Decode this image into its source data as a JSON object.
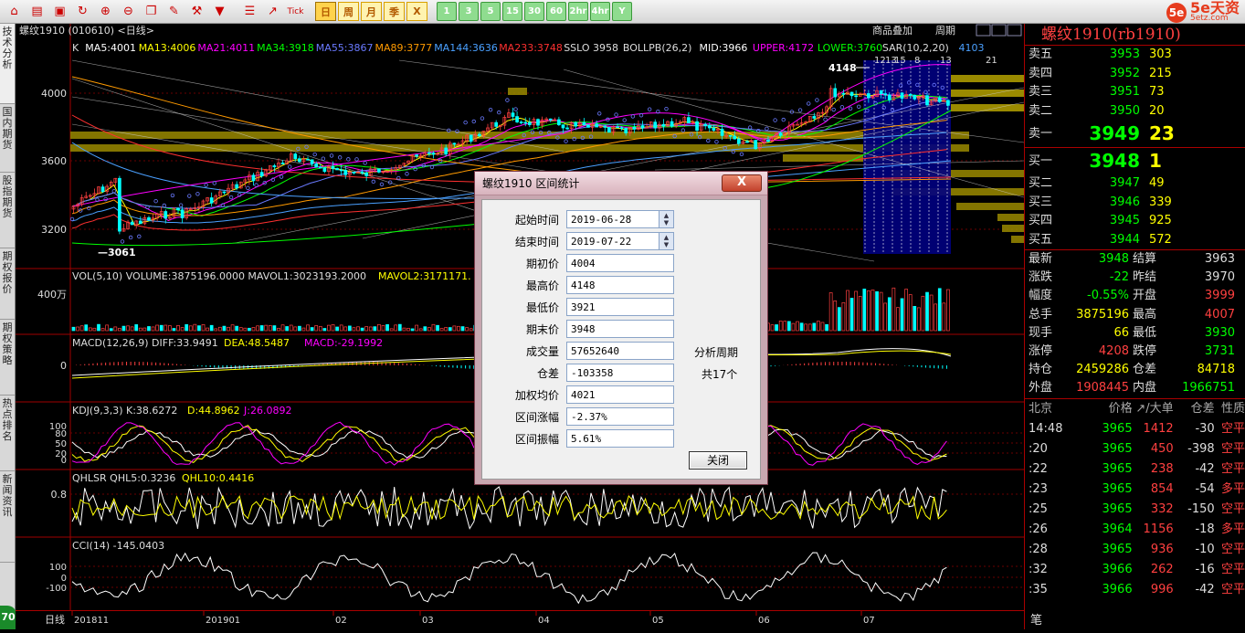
{
  "toolbar": {
    "icons": [
      "home-icon",
      "data-icon",
      "f10-icon",
      "refresh-icon",
      "zoom-in-icon",
      "zoom-out-icon",
      "window-icon",
      "pen-icon",
      "tool-icon",
      "filter-icon",
      "table-icon",
      "trend-icon",
      "tick-icon"
    ],
    "tick_label": "Tick",
    "periods": [
      "日",
      "周",
      "月",
      "季",
      "X"
    ],
    "minutes": [
      "1",
      "3",
      "5",
      "15",
      "30",
      "60",
      "2hr",
      "4hr",
      "Y"
    ],
    "selected_period": "日"
  },
  "logo": {
    "circle": "5e",
    "text": "5e天资",
    "sub": "5etz.com"
  },
  "left_tabs": [
    "技术分析",
    "国内期货",
    "股指期货",
    "期权报价",
    "期权策略",
    "热点排名",
    "新闻资讯"
  ],
  "badge": "70",
  "chart": {
    "header_label": "螺纹1910 (010610) <日线>",
    "top_right_labels": [
      "商品叠加",
      "周期"
    ],
    "ma_line": [
      {
        "text": "K",
        "color": "#dddddd"
      },
      {
        "text": "MA5:4001",
        "color": "#ffffff"
      },
      {
        "text": "MA13:4006",
        "color": "#ffff00"
      },
      {
        "text": "MA21:4011",
        "color": "#ff00ff"
      },
      {
        "text": "MA34:3918",
        "color": "#00ff00"
      },
      {
        "text": "MA55:3867",
        "color": "#6a7aff"
      },
      {
        "text": "MA89:3777",
        "color": "#ff9a00"
      },
      {
        "text": "MA144:3636",
        "color": "#4aa0ff"
      },
      {
        "text": "MA233:3748",
        "color": "#ff3030"
      },
      {
        "text": "SSLO 3958",
        "color": "#dddddd"
      },
      {
        "text": "BOLLPB(26,2)",
        "color": "#dddddd"
      },
      {
        "text": "MID:3966",
        "color": "#ffffff"
      },
      {
        "text": "UPPER:4172",
        "color": "#ff00ff"
      },
      {
        "text": "LOWER:3760",
        "color": "#00ff00"
      },
      {
        "text": "SAR(10,2,20)",
        "color": "#dddddd"
      },
      {
        "text": "4103",
        "color": "#4aa0ff"
      }
    ],
    "price_ticks": [
      "4000",
      "3600",
      "3200"
    ],
    "high_marker": "4148",
    "low_marker": "3061",
    "vol_label": "VOL(5,10) VOLUME:3875196.0000 MAVOL1:3023193.2000",
    "vol_label2": "MAVOL2:3171171.",
    "vol_tick": "400万",
    "macd_label": "MACD(12,26,9) DIFF:33.9491",
    "macd_dea": "DEA:48.5487",
    "macd_val": "MACD:-29.1992",
    "macd_tick": "0",
    "kdj_label": "KDJ(9,3,3) K:38.6272",
    "kdj_d": "D:44.8962",
    "kdj_j": "J:26.0892",
    "kdj_ticks": [
      "100",
      "80",
      "50",
      "20",
      "0"
    ],
    "qhlsr_label": "QHLSR QHL5:0.3236",
    "qhlsr_2": "QHL10:0.4416",
    "qhlsr_tick": "0.8",
    "cci_label": "CCI(14) -145.0403",
    "cci_ticks": [
      "100",
      "0",
      "-100"
    ],
    "interval_days": [
      "12",
      "13",
      "15",
      "8",
      "13",
      "21"
    ]
  },
  "xaxis": {
    "period": "日线",
    "labels": [
      "201811",
      "201901",
      "02",
      "03",
      "04",
      "05",
      "06",
      "07"
    ]
  },
  "right_panel": {
    "title": "螺纹1910(rb1910)",
    "asks": [
      {
        "label": "卖五",
        "price": "3953",
        "vol": "303"
      },
      {
        "label": "卖四",
        "price": "3952",
        "vol": "215"
      },
      {
        "label": "卖三",
        "price": "3951",
        "vol": "73"
      },
      {
        "label": "卖二",
        "price": "3950",
        "vol": "20"
      }
    ],
    "ask1": {
      "label": "卖一",
      "price": "3949",
      "vol": "23"
    },
    "bid1": {
      "label": "买一",
      "price": "3948",
      "vol": "1"
    },
    "bids": [
      {
        "label": "买二",
        "price": "3947",
        "vol": "49"
      },
      {
        "label": "买三",
        "price": "3946",
        "vol": "339"
      },
      {
        "label": "买四",
        "price": "3945",
        "vol": "925"
      },
      {
        "label": "买五",
        "price": "3944",
        "vol": "572"
      }
    ],
    "quotes": [
      [
        {
          "l": "最新",
          "v": "3948",
          "c": "g"
        },
        {
          "l": "结算",
          "v": "3963",
          "c": "w"
        }
      ],
      [
        {
          "l": "涨跌",
          "v": "-22",
          "c": "g"
        },
        {
          "l": "昨结",
          "v": "3970",
          "c": "w"
        }
      ],
      [
        {
          "l": "幅度",
          "v": "-0.55%",
          "c": "g"
        },
        {
          "l": "开盘",
          "v": "3999",
          "c": "r"
        }
      ],
      [
        {
          "l": "总手",
          "v": "3875196",
          "c": "y"
        },
        {
          "l": "最高",
          "v": "4007",
          "c": "r"
        }
      ],
      [
        {
          "l": "现手",
          "v": "66",
          "c": "y"
        },
        {
          "l": "最低",
          "v": "3930",
          "c": "g"
        }
      ],
      [
        {
          "l": "涨停",
          "v": "4208",
          "c": "r"
        },
        {
          "l": "跌停",
          "v": "3731",
          "c": "g"
        }
      ],
      [
        {
          "l": "持仓",
          "v": "2459286",
          "c": "y"
        },
        {
          "l": "仓差",
          "v": "84718",
          "c": "y"
        }
      ],
      [
        {
          "l": "外盘",
          "v": "1908445",
          "c": "r"
        },
        {
          "l": "内盘",
          "v": "1966751",
          "c": "g"
        }
      ]
    ],
    "tick_header": [
      "北京",
      "价格",
      "↗/大单",
      "仓差",
      "性质"
    ],
    "ticks": [
      {
        "t": "14:48",
        "p": "3965",
        "v": "1412",
        "d": "-30",
        "n": "空平"
      },
      {
        "t": ":20",
        "p": "3965",
        "v": "450",
        "d": "-398",
        "n": "空平"
      },
      {
        "t": ":22",
        "p": "3965",
        "v": "238",
        "d": "-42",
        "n": "空平"
      },
      {
        "t": ":23",
        "p": "3965",
        "v": "854",
        "d": "-54",
        "n": "多平"
      },
      {
        "t": ":25",
        "p": "3965",
        "v": "332",
        "d": "-150",
        "n": "空平"
      },
      {
        "t": ":26",
        "p": "3964",
        "v": "1156",
        "d": "-18",
        "n": "多平"
      },
      {
        "t": ":28",
        "p": "3965",
        "v": "936",
        "d": "-10",
        "n": "空平"
      },
      {
        "t": ":32",
        "p": "3966",
        "v": "262",
        "d": "-16",
        "n": "空平"
      },
      {
        "t": ":35",
        "p": "3966",
        "v": "996",
        "d": "-42",
        "n": "空平"
      }
    ],
    "footer_tab": "笔"
  },
  "dialog": {
    "title": "螺纹1910 区间统计",
    "close_x": "X",
    "fields": [
      {
        "label": "起始时间",
        "value": "2019-06-28"
      },
      {
        "label": "结束时间",
        "value": "2019-07-22"
      },
      {
        "label": "期初价",
        "value": "4004"
      },
      {
        "label": "最高价",
        "value": "4148"
      },
      {
        "label": "最低价",
        "value": "3921"
      },
      {
        "label": "期末价",
        "value": "3948"
      },
      {
        "label": "成交量",
        "value": "57652640"
      },
      {
        "label": "仓差",
        "value": "-103358"
      },
      {
        "label": "加权均价",
        "value": "4021"
      },
      {
        "label": "区间涨幅",
        "value": "-2.37%"
      },
      {
        "label": "区间振幅",
        "value": "5.61%"
      }
    ],
    "period_label": "分析周期",
    "period_count": "共17个",
    "close_button": "关闭"
  },
  "colors": {
    "up": "#ff4040",
    "down": "#00ffff",
    "ma_yellow": "#ffff00",
    "grid": "#a00000",
    "band": "#9a8a00",
    "interval_fill": "#000080"
  }
}
